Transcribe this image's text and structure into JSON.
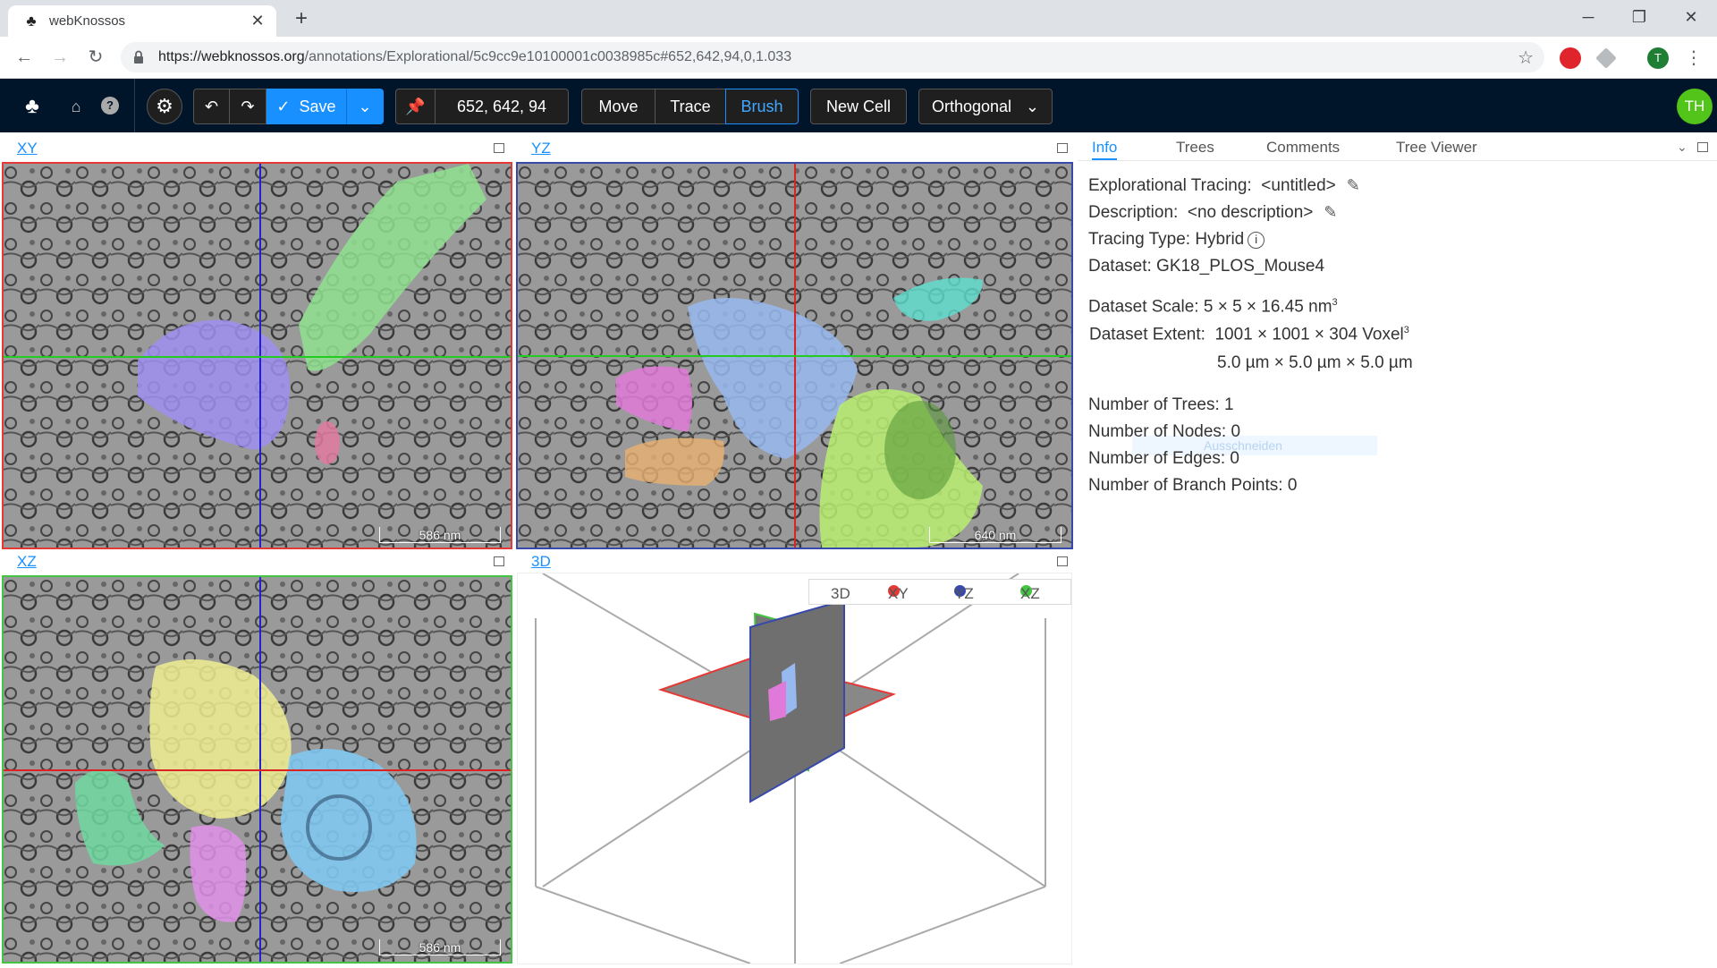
{
  "browser": {
    "tab_title": "webKnossos",
    "url_host": "https://webknossos.org",
    "url_path": "/annotations/Explorational/5c9cc9e10100001c0038985c#652,642,94,0,1.033",
    "profile_initial": "T"
  },
  "toolbar": {
    "save_label": "Save",
    "position": "652, 642, 94",
    "tools": [
      "Move",
      "Trace",
      "Brush"
    ],
    "active_tool": "Brush",
    "new_cell_label": "New Cell",
    "view_mode": "Orthogonal",
    "avatar_initials": "TH"
  },
  "viewports": {
    "xy": {
      "label": "XY",
      "scale": "586 nm",
      "border_color": "#e53935"
    },
    "yz": {
      "label": "YZ",
      "scale": "640 nm",
      "border_color": "#3949ab"
    },
    "xz": {
      "label": "XZ",
      "scale": "586 nm",
      "border_color": "#43c443"
    },
    "td": {
      "label": "3D"
    }
  },
  "legend3d": {
    "items": [
      {
        "label": "3D",
        "color": ""
      },
      {
        "label": "XY",
        "color": "#e53935"
      },
      {
        "label": "YZ",
        "color": "#3949ab"
      },
      {
        "label": "XZ",
        "color": "#43c443"
      }
    ]
  },
  "panel": {
    "tabs": [
      "Info",
      "Trees",
      "Comments",
      "Tree Viewer"
    ],
    "tracing_label": "Explorational Tracing:",
    "tracing_value": "<untitled>",
    "description_label": "Description:",
    "description_value": "<no description>",
    "tracing_type": "Tracing Type: Hybrid",
    "dataset": "Dataset: GK18_PLOS_Mouse4",
    "scale_label": "Dataset Scale:",
    "scale_value": "5 × 5 × 16.45 nm",
    "extent_label": "Dataset Extent:",
    "extent_voxel": "1001 × 1001 × 304 Voxel",
    "extent_um": "5.0 µm × 5.0 µm × 5.0 µm",
    "trees": "Number of Trees: 1",
    "nodes": "Number of Nodes: 0",
    "edges": "Number of Edges: 0",
    "branch_points": "Number of Branch Points: 0",
    "ghost_text": "Ausschneiden"
  }
}
